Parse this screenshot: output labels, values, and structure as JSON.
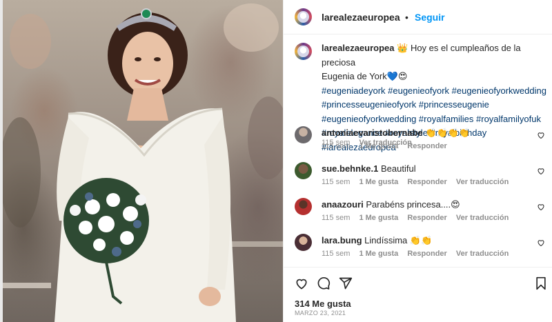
{
  "post": {
    "username": "larealezaeuropea",
    "follow_label": "Seguir",
    "separator": "•",
    "caption": {
      "author": "larealezaeuropea",
      "text_line1": "👑 Hoy es el cumpleaños de la preciosa",
      "text_line2": "Eugenia de York💙😍",
      "hashtags_line1": "#eugeniadeyork #eugenieofyork #eugenieofyorkwedding",
      "hashtags_line2": "#princesseugenieofyork #princesseugenie",
      "hashtags_line3": "#eugenieofyorkwedding #royalfamilies #royalfamilyofuk",
      "hashtags_line4": "#royalelegance #royalstyle #royalbirthday #larealezaeuropea",
      "time": "115 sem",
      "translate": "Ver traducción"
    },
    "comments": [
      {
        "username": "antoniaevaristobernabe",
        "text": "👏👏👏👏",
        "time": "115 sem",
        "likes": "1 Me gusta",
        "reply": "Responder",
        "translate": ""
      },
      {
        "username": "sue.behnke.1",
        "text": "Beautiful",
        "time": "115 sem",
        "likes": "1 Me gusta",
        "reply": "Responder",
        "translate": "Ver traducción"
      },
      {
        "username": "anaazouri",
        "text": "Parabéns princesa....😍",
        "time": "115 sem",
        "likes": "1 Me gusta",
        "reply": "Responder",
        "translate": "Ver traducción"
      },
      {
        "username": "lara.bung",
        "text": "Lindíssima 👏👏",
        "time": "115 sem",
        "likes": "1 Me gusta",
        "reply": "Responder",
        "translate": "Ver traducción"
      }
    ],
    "likes_count": "314 Me gusta",
    "date": "MARZO 23, 2021",
    "icons": [
      "heart-icon",
      "comment-icon",
      "share-icon",
      "bookmark-icon"
    ],
    "colors": {
      "link": "#00376b",
      "follow": "#0095f6",
      "meta": "#8e8e8e",
      "text": "#262626"
    }
  }
}
